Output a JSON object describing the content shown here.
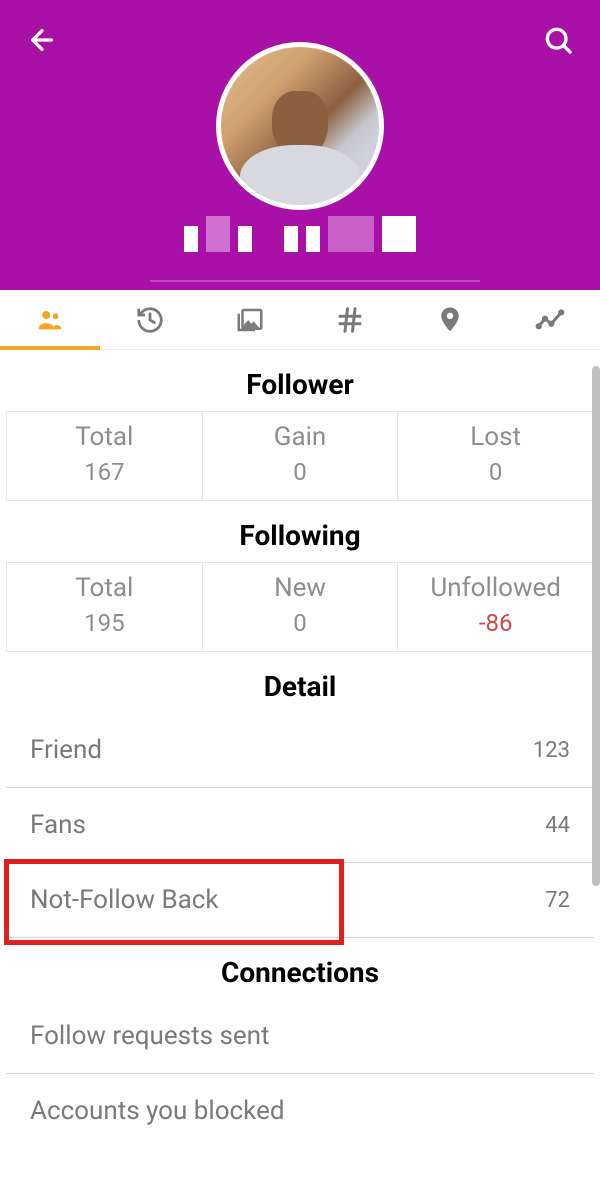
{
  "header": {
    "avatar_alt": "profile-photo"
  },
  "tabs": {
    "active_index": 0
  },
  "sections": {
    "follower": {
      "title": "Follower",
      "stats": [
        {
          "label": "Total",
          "value": "167"
        },
        {
          "label": "Gain",
          "value": "0"
        },
        {
          "label": "Lost",
          "value": "0"
        }
      ]
    },
    "following": {
      "title": "Following",
      "stats": [
        {
          "label": "Total",
          "value": "195"
        },
        {
          "label": "New",
          "value": "0"
        },
        {
          "label": "Unfollowed",
          "value": "-86",
          "negative": true
        }
      ]
    },
    "detail": {
      "title": "Detail",
      "rows": [
        {
          "label": "Friend",
          "value": "123"
        },
        {
          "label": "Fans",
          "value": "44"
        },
        {
          "label": "Not-Follow Back",
          "value": "72",
          "highlighted": true
        }
      ]
    },
    "connections": {
      "title": "Connections",
      "rows": [
        {
          "label": "Follow requests sent"
        },
        {
          "label": "Accounts you blocked"
        }
      ]
    }
  }
}
